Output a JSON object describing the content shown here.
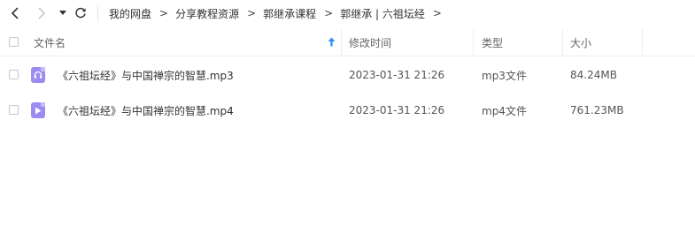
{
  "nav": {
    "back_icon": "chevron-left-icon",
    "forward_icon": "chevron-right-icon",
    "history_icon": "caret-down-icon",
    "refresh_icon": "refresh-icon"
  },
  "breadcrumb": [
    "我的网盘",
    "分享教程资源",
    "郭继承课程",
    "郭继承 | 六祖坛经"
  ],
  "breadcrumb_separator": ">",
  "columns": {
    "name": "文件名",
    "modified": "修改时间",
    "type": "类型",
    "size": "大小"
  },
  "sort": {
    "column": "name",
    "icon": "sort-arrow-up-icon",
    "color": "#2b8ff0"
  },
  "files": [
    {
      "name": "《六祖坛经》与中国禅宗的智慧.mp3",
      "modified": "2023-01-31 21:26",
      "type": "mp3文件",
      "size": "84.24MB",
      "icon": "audio-file-icon"
    },
    {
      "name": "《六祖坛经》与中国禅宗的智慧.mp4",
      "modified": "2023-01-31 21:26",
      "type": "mp4文件",
      "size": "761.23MB",
      "icon": "video-file-icon"
    }
  ],
  "colors": {
    "file_icon": "#9b8cf0",
    "disabled_nav": "#c8c8c8"
  }
}
